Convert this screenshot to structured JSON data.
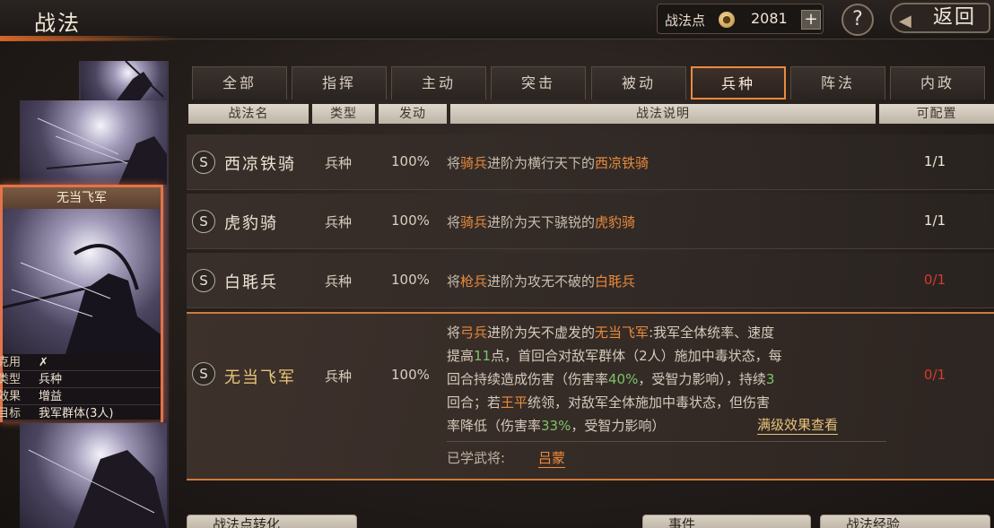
{
  "header": {
    "title": "战法",
    "points_label": "战法点",
    "points_value": "2081",
    "plus": "+",
    "help": "?",
    "back": "返回"
  },
  "side_card": {
    "name": "无当飞军",
    "info": [
      {
        "k": "克用",
        "v": "✗"
      },
      {
        "k": "类型",
        "v": "兵种"
      },
      {
        "k": "效果",
        "v": "增益"
      },
      {
        "k": "目标",
        "v": "我军群体(3人)"
      }
    ]
  },
  "tabs": [
    {
      "label": "全部",
      "active": false
    },
    {
      "label": "指挥",
      "active": false
    },
    {
      "label": "主动",
      "active": false
    },
    {
      "label": "突击",
      "active": false
    },
    {
      "label": "被动",
      "active": false
    },
    {
      "label": "兵种",
      "active": true
    },
    {
      "label": "阵法",
      "active": false
    },
    {
      "label": "内政",
      "active": false
    }
  ],
  "columns": [
    "战法名",
    "类型",
    "发动",
    "战法说明",
    "可配置"
  ],
  "rows": [
    {
      "badge": "S",
      "name": "西凉铁骑",
      "type": "兵种",
      "rate": "100%",
      "desc_a": "将",
      "desc_b": "骑兵",
      "desc_c": "进阶为横行天下的",
      "desc_d": "西凉铁骑",
      "config": "1/1"
    },
    {
      "badge": "S",
      "name": "虎豹骑",
      "type": "兵种",
      "rate": "100%",
      "desc_a": "将",
      "desc_b": "骑兵",
      "desc_c": "进阶为天下骁锐的",
      "desc_d": "虎豹骑",
      "config": "1/1"
    },
    {
      "badge": "S",
      "name": "白毦兵",
      "type": "兵种",
      "rate": "100%",
      "desc_a": "将",
      "desc_b": "枪兵",
      "desc_c": "进阶为攻无不破的",
      "desc_d": "白毦兵",
      "config": "0/1"
    }
  ],
  "selected": {
    "badge": "S",
    "name": "无当飞军",
    "type": "兵种",
    "rate": "100%",
    "config": "0/1",
    "l1": {
      "a": "将",
      "b": "弓兵",
      "c": "进阶为矢不虚发的",
      "d": "无当飞军",
      "e": ":我军全体统率、速度"
    },
    "l2": {
      "a": "提高",
      "b": "11",
      "c": "点，首回合对敌军群体（2人）施加中毒状态，每"
    },
    "l3": {
      "a": "回合持续造成伤害（伤害率",
      "b": "40%",
      "c": "，受智力影响），持续",
      "d": "3"
    },
    "l4": {
      "a": "回合；若",
      "b": "王平",
      "c": "统领，对敌军全体施加中毒状态，但伤害"
    },
    "l5": {
      "a": "率降低（伤害率",
      "b": "33%",
      "c": "，受智力影响）"
    },
    "full_link": "满级效果查看",
    "learned_label": "已学武将:",
    "learned_name": "吕蒙"
  },
  "bottom_buttons": [
    "战法点转化",
    "事件",
    "战法经验"
  ],
  "colors": {
    "accent": "#ee8a3c",
    "red": "#d63a2e",
    "green": "#7cc46a",
    "gold": "#e9c47a"
  }
}
